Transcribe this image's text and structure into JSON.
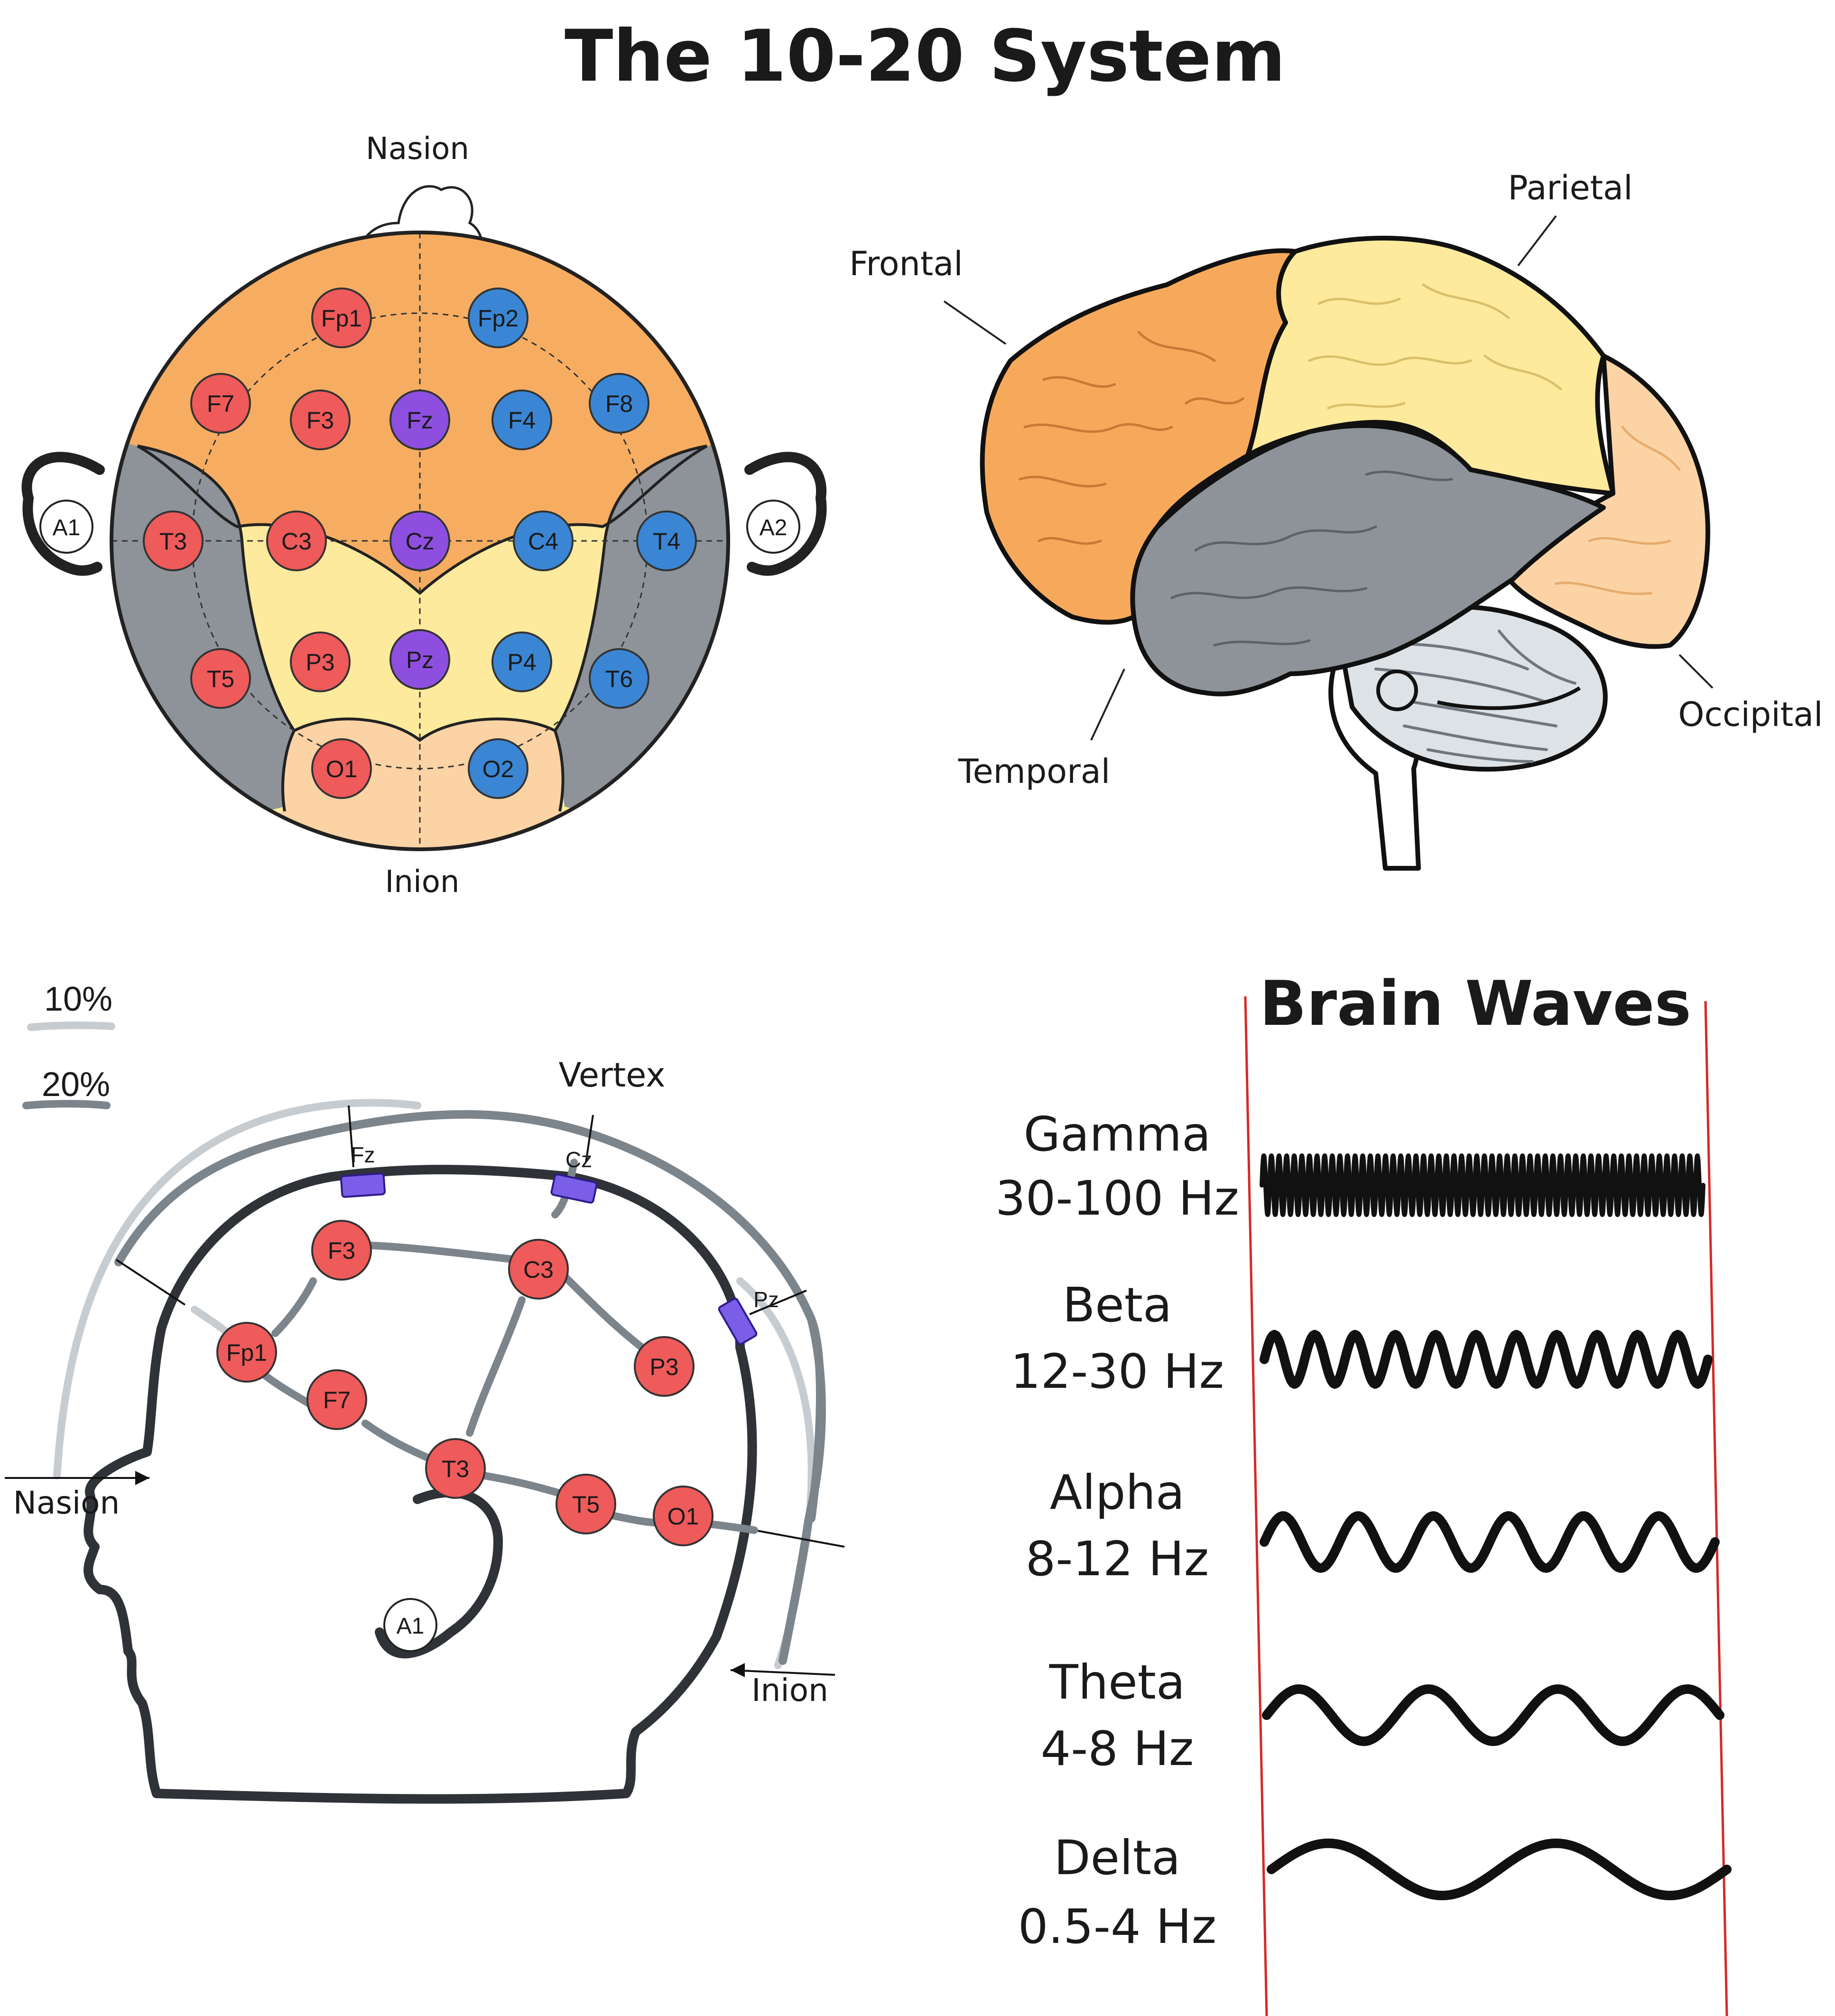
{
  "title": "The 10-20 System",
  "top_view": {
    "labels": {
      "nasion": "Nasion",
      "inion": "Inion"
    },
    "ears": [
      "A1",
      "A2"
    ],
    "electrodes": [
      {
        "id": "Fp1",
        "color": "#ef5a5a"
      },
      {
        "id": "Fp2",
        "color": "#3a86d4"
      },
      {
        "id": "F7",
        "color": "#ef5a5a"
      },
      {
        "id": "F3",
        "color": "#ef5a5a"
      },
      {
        "id": "Fz",
        "color": "#8e4fe0"
      },
      {
        "id": "F4",
        "color": "#3a86d4"
      },
      {
        "id": "F8",
        "color": "#3a86d4"
      },
      {
        "id": "T3",
        "color": "#ef5a5a"
      },
      {
        "id": "C3",
        "color": "#ef5a5a"
      },
      {
        "id": "Cz",
        "color": "#8e4fe0"
      },
      {
        "id": "C4",
        "color": "#3a86d4"
      },
      {
        "id": "T4",
        "color": "#3a86d4"
      },
      {
        "id": "T5",
        "color": "#ef5a5a"
      },
      {
        "id": "P3",
        "color": "#ef5a5a"
      },
      {
        "id": "Pz",
        "color": "#8e4fe0"
      },
      {
        "id": "P4",
        "color": "#3a86d4"
      },
      {
        "id": "T6",
        "color": "#3a86d4"
      },
      {
        "id": "O1",
        "color": "#ef5a5a"
      },
      {
        "id": "O2",
        "color": "#3a86d4"
      }
    ]
  },
  "brain": {
    "lobes": {
      "frontal": "Frontal",
      "parietal": "Parietal",
      "temporal": "Temporal",
      "occipital": "Occipital"
    },
    "colors": {
      "frontal": "#f6a95a",
      "parietal": "#fdea9c",
      "temporal": "#8d9398",
      "occipital": "#fcd3a4",
      "cerebellum": "#dde2e6"
    }
  },
  "side_view": {
    "legend": [
      {
        "label": "10%",
        "color": "#c7ccd1"
      },
      {
        "label": "20%",
        "color": "#7c848c"
      }
    ],
    "labels": {
      "vertex": "Vertex",
      "nasion": "Nasion",
      "inion": "Inion"
    },
    "midline": [
      "Fz",
      "Cz",
      "Pz"
    ],
    "electrodes": [
      "F3",
      "C3",
      "Fp1",
      "P3",
      "F7",
      "T3",
      "T5",
      "O1"
    ],
    "ear": "A1"
  },
  "brain_waves": {
    "title": "Brain Waves",
    "waves": [
      {
        "name": "Gamma",
        "range": "30-100 Hz"
      },
      {
        "name": "Beta",
        "range": "12-30 Hz"
      },
      {
        "name": "Alpha",
        "range": "8-12 Hz"
      },
      {
        "name": "Theta",
        "range": "4-8 Hz"
      },
      {
        "name": "Delta",
        "range": "0.5-4 Hz"
      }
    ]
  },
  "colors": {
    "red_electrode": "#ef5a5a",
    "blue_electrode": "#3a86d4",
    "purple_electrode": "#8e4fe0",
    "guide_line": "#d62828"
  }
}
